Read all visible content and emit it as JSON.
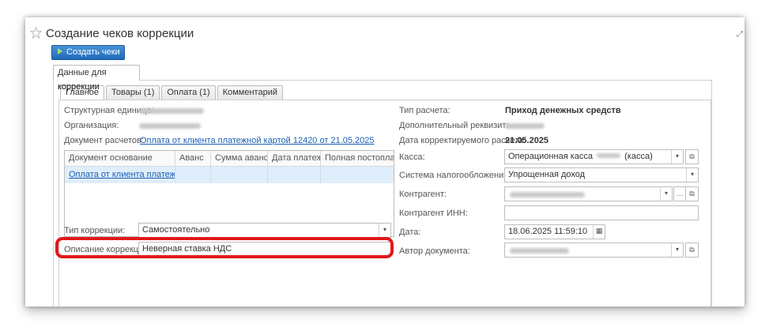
{
  "window": {
    "title": "Создание чеков коррекции",
    "create_button": "Создать чеки"
  },
  "outer_tab": "Данные для коррекции",
  "tabs": [
    "Главное",
    "Товары (1)",
    "Оплата (1)",
    "Комментарий"
  ],
  "left": {
    "unit_label": "Структурная единица:",
    "org_label": "Организация:",
    "doc_label": "Документ расчетов:",
    "doc_value": "Оплата от клиента платежной картой 12420 от 21.05.2025",
    "grid": {
      "columns": [
        "Документ основание",
        "Аванс",
        "Сумма аванса",
        "Дата платежа",
        "Полная постоплата"
      ],
      "rows": [
        [
          "Оплата от клиента платежн...",
          "",
          "",
          "",
          ""
        ]
      ]
    },
    "corr_type_label": "Тип коррекции:",
    "corr_type_value": "Самостоятельно",
    "corr_desc_label": "Описание коррекции:",
    "corr_desc_value": "Неверная ставка НДС"
  },
  "right": {
    "calc_type_label": "Тип расчета:",
    "calc_type_value": "Приход денежных средств",
    "extra_label": "Дополнительный реквизит:",
    "date_corr_label": "Дата корректируемого расчета:",
    "date_corr_value": "21.05.2025",
    "kassa_label": "Касса:",
    "kassa_value_a": "Операционная касса",
    "kassa_value_b": "(касса)",
    "tax_label": "Система налогообложения:",
    "tax_value": "Упрощенная доход",
    "contractor_label": "Контрагент:",
    "contractor_inn_label": "Контрагент ИНН:",
    "date_label": "Дата:",
    "date_value": "18.06.2025 11:59:10",
    "author_label": "Автор документа:"
  }
}
